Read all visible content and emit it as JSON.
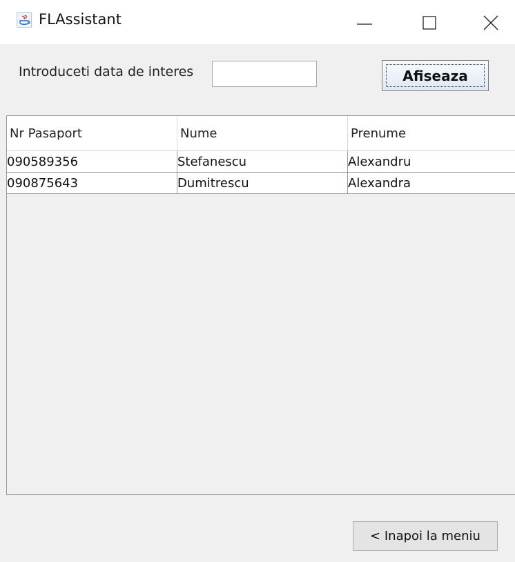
{
  "window": {
    "title": "FLAssistant",
    "controls": {
      "minimize": "minimize-icon",
      "maximize": "maximize-icon",
      "close": "close-icon"
    }
  },
  "form": {
    "date_label": "Introduceti data de interes",
    "date_value": "",
    "show_button": "Afiseaza"
  },
  "table": {
    "headers": [
      "Nr Pasaport",
      "Nume",
      "Prenume"
    ],
    "rows": [
      [
        "090589356",
        "Stefanescu",
        "Alexandru"
      ],
      [
        "090875643",
        "Dumitrescu",
        "Alexandra"
      ]
    ]
  },
  "footer": {
    "back_button": "< Inapoi la meniu"
  }
}
